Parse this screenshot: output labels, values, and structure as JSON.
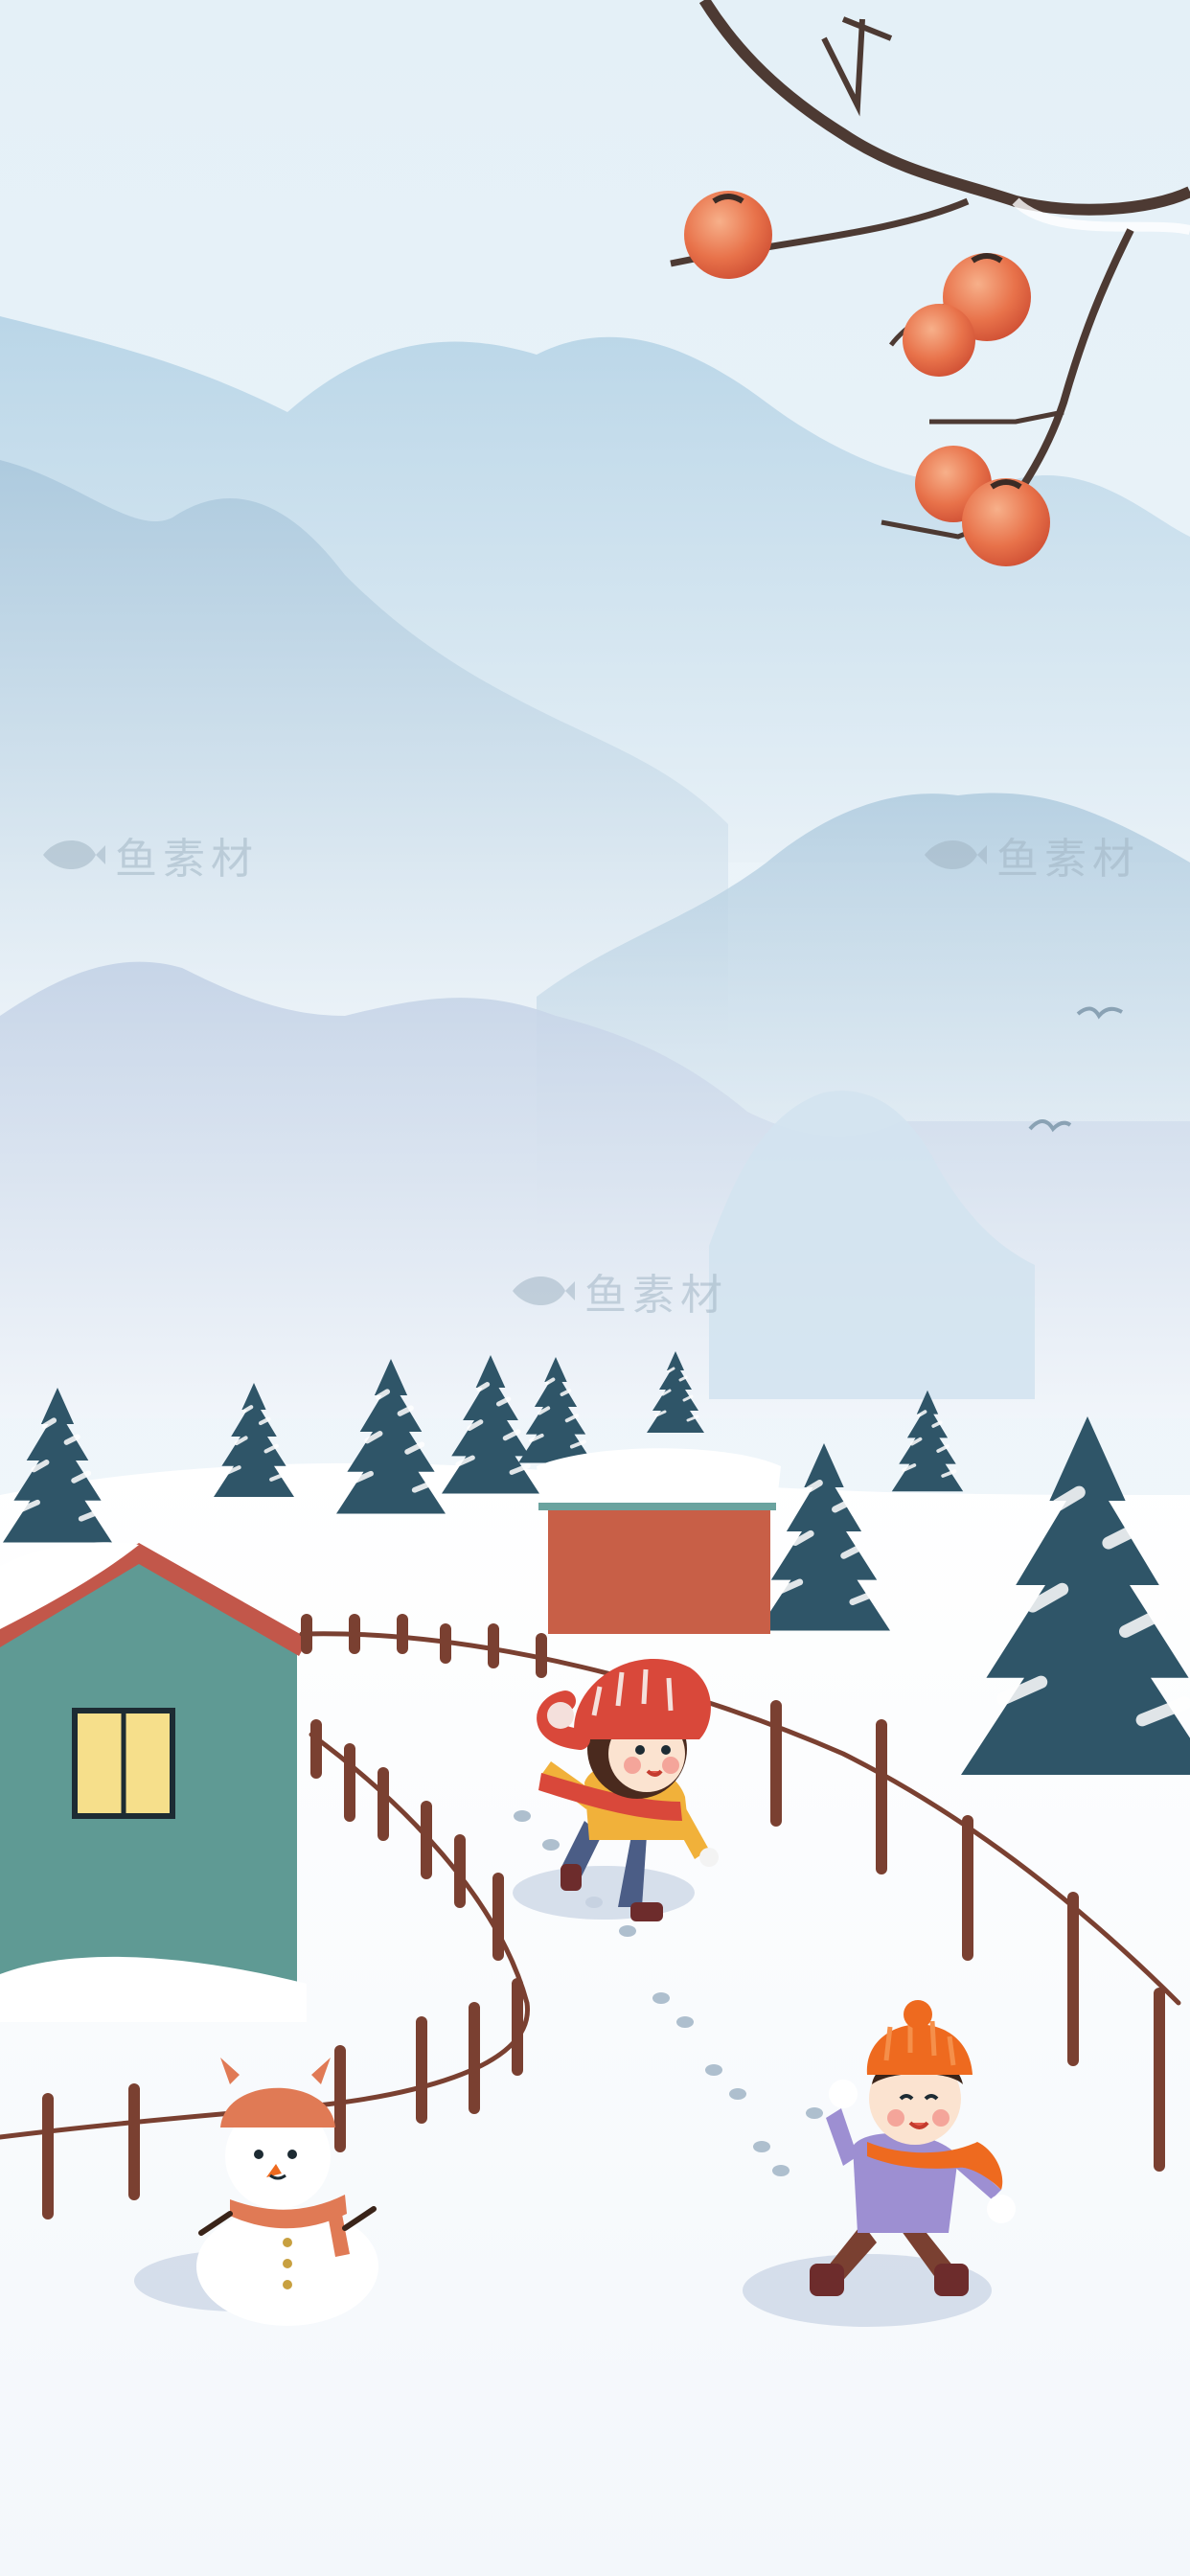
{
  "scene": {
    "description_key": "winter-village-illustration",
    "palette": {
      "sky_top": "#e3eff6",
      "mountain": "#bcd6e6",
      "mountain_dark": "#9fbfd6",
      "snow": "#ffffff",
      "pine": "#2f5568",
      "house_wall": "#5f9a94",
      "house_roof": "#c2574a",
      "shed": "#c85f47",
      "fence": "#7a4031",
      "hat_red": "#d9483a",
      "hat_orange": "#ee6a1f",
      "persimmon": "#e8724a"
    }
  },
  "watermarks": [
    {
      "id": "wm1",
      "text": "鱼素材"
    },
    {
      "id": "wm2",
      "text": "鱼素材"
    },
    {
      "id": "wm3",
      "text": "鱼素材"
    }
  ]
}
